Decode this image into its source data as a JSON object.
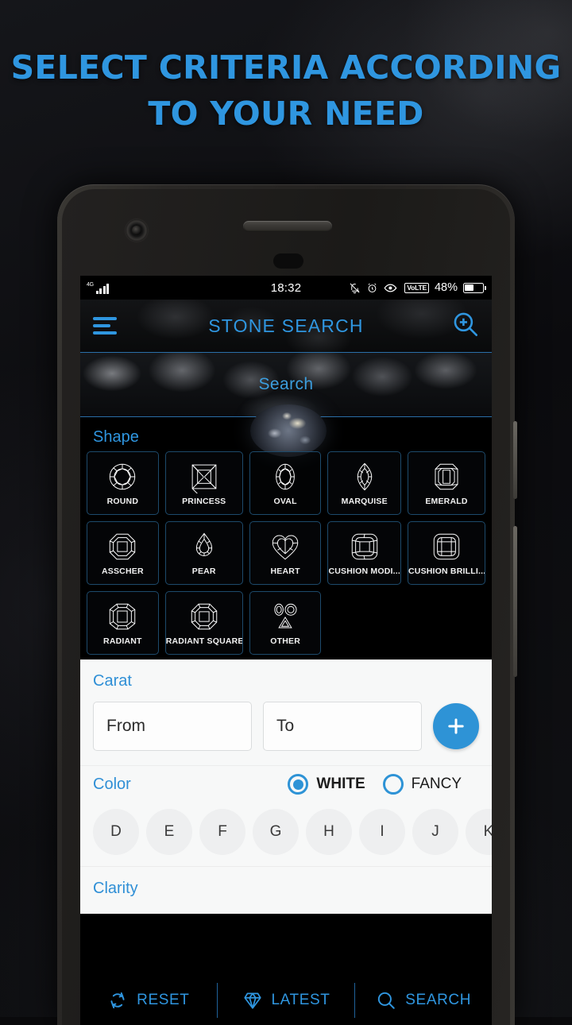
{
  "headline": {
    "line1": "SELECT CRITERIA ACCORDING",
    "line2": "TO YOUR NEED",
    "color": "#2f96e0"
  },
  "status_bar": {
    "network": "4G",
    "time": "18:32",
    "icons": [
      "bell-off-icon",
      "alarm-icon",
      "eye-icon"
    ],
    "volte": "VoLTE",
    "battery_percent": "48%"
  },
  "app_bar": {
    "title": "STONE SEARCH",
    "menu_icon": "hamburger-menu-icon",
    "action_icon": "zoom-in-search-icon",
    "accent": "#2f96e0"
  },
  "search": {
    "placeholder": "Search"
  },
  "shape": {
    "label": "Shape",
    "items": [
      {
        "name": "ROUND",
        "icon": "round-diamond-icon"
      },
      {
        "name": "PRINCESS",
        "icon": "princess-diamond-icon"
      },
      {
        "name": "OVAL",
        "icon": "oval-diamond-icon"
      },
      {
        "name": "MARQUISE",
        "icon": "marquise-diamond-icon"
      },
      {
        "name": "EMERALD",
        "icon": "emerald-diamond-icon"
      },
      {
        "name": "ASSCHER",
        "icon": "asscher-diamond-icon"
      },
      {
        "name": "PEAR",
        "icon": "pear-diamond-icon"
      },
      {
        "name": "HEART",
        "icon": "heart-diamond-icon"
      },
      {
        "name": "CUSHION MODI...",
        "icon": "cushion-modified-diamond-icon"
      },
      {
        "name": "CUSHION BRILLI...",
        "icon": "cushion-brilliant-diamond-icon"
      },
      {
        "name": "RADIANT",
        "icon": "radiant-diamond-icon"
      },
      {
        "name": "RADIANT SQUARE",
        "icon": "radiant-square-diamond-icon"
      },
      {
        "name": "OTHER",
        "icon": "other-shapes-icon"
      }
    ]
  },
  "carat": {
    "label": "Carat",
    "from_placeholder": "From",
    "to_placeholder": "To",
    "from_value": "",
    "to_value": "",
    "add_icon": "plus-icon",
    "add_color": "#2e93d6"
  },
  "color": {
    "label": "Color",
    "options": [
      {
        "label": "WHITE",
        "selected": true
      },
      {
        "label": "FANCY",
        "selected": false
      }
    ],
    "grades": [
      "D",
      "E",
      "F",
      "G",
      "H",
      "I",
      "J",
      "K"
    ]
  },
  "clarity": {
    "label": "Clarity"
  },
  "bottom_bar": {
    "items": [
      {
        "label": "RESET",
        "icon": "refresh-icon"
      },
      {
        "label": "LATEST",
        "icon": "diamond-icon"
      },
      {
        "label": "SEARCH",
        "icon": "magnifier-icon"
      }
    ],
    "accent": "#2f96e0"
  }
}
